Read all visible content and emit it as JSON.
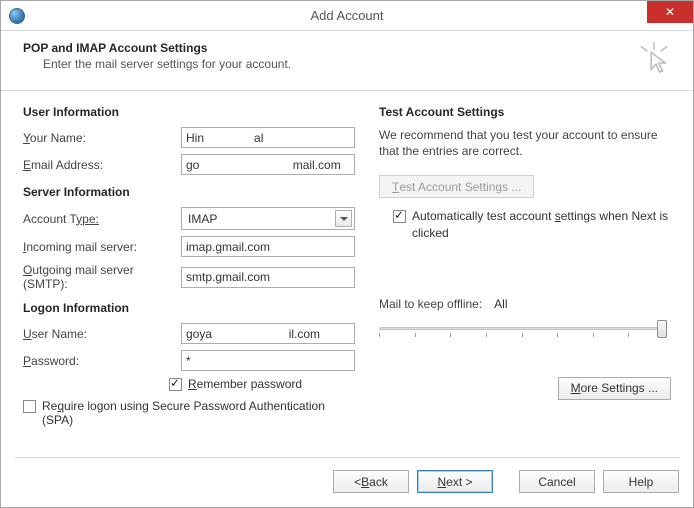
{
  "window": {
    "title": "Add Account",
    "close_glyph": "✕"
  },
  "header": {
    "title": "POP and IMAP Account Settings",
    "subtitle": "Enter the mail server settings for your account."
  },
  "sections": {
    "user_info": "User Information",
    "server_info": "Server Information",
    "logon_info": "Logon Information",
    "test_settings": "Test Account Settings"
  },
  "labels": {
    "your_name_pre": "Y",
    "your_name_post": "our Name:",
    "email_pre": "E",
    "email_post": "mail Address:",
    "account_type_pre": "Account T",
    "account_type_post": "ype:",
    "incoming_pre": "I",
    "incoming_post": "ncoming mail server:",
    "outgoing_pre": "O",
    "outgoing_post": "utgoing mail server (SMTP):",
    "username_pre": "U",
    "username_post": "ser Name:",
    "password_pre": "P",
    "password_post": "assword:",
    "remember_pre": "R",
    "remember_post": "emember password",
    "spa_pre": "Re",
    "spa_u": "q",
    "spa_post": "uire logon using Secure Password Authentication (SPA)"
  },
  "values": {
    "your_name": "Hin               al",
    "email": "go                            mail.com",
    "account_type": "IMAP",
    "incoming": "imap.gmail.com",
    "outgoing": "smtp.gmail.com",
    "username": "goya                       il.com",
    "password": "*",
    "remember_checked": true,
    "spa_checked": false
  },
  "right": {
    "desc": "We recommend that you test your account to ensure that the entries are correct.",
    "test_button_pre": "T",
    "test_button_post": "est Account Settings ...",
    "auto_test_pre": "Automatically test account ",
    "auto_test_u": "s",
    "auto_test_post": "ettings when Next is clicked",
    "auto_test_checked": true,
    "slider_label": "Mail to keep offline:",
    "slider_value": "All",
    "more_pre": "M",
    "more_post": "ore Settings ..."
  },
  "footer": {
    "back_pre": "< ",
    "back_u": "B",
    "back_post": "ack",
    "next_pre": "N",
    "next_post": "ext >",
    "cancel": "Cancel",
    "help": "Help"
  }
}
